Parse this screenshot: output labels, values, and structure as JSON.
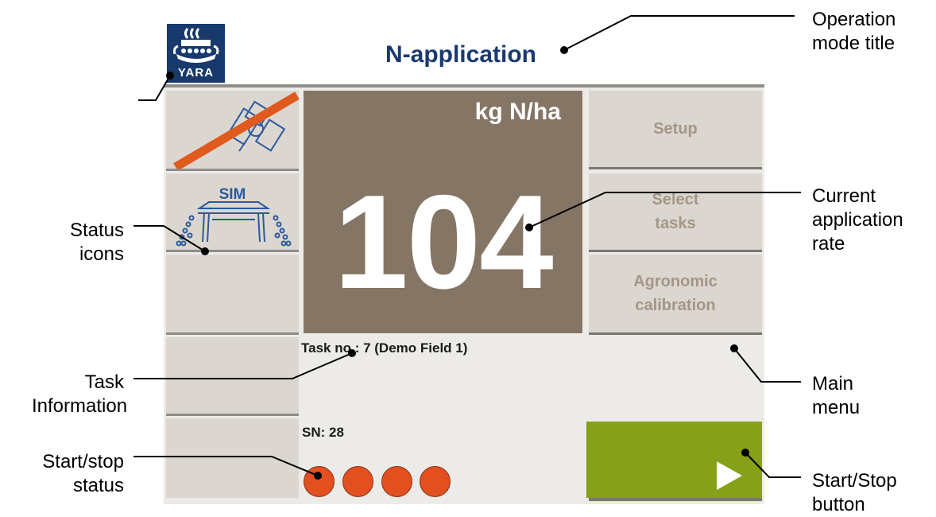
{
  "header": {
    "title": "N-application",
    "logo_text": "YARA"
  },
  "status_icons": [
    {
      "name": "gps-satellite-icon",
      "state": "no signal"
    },
    {
      "name": "spreader-sim-icon",
      "label": "SIM"
    }
  ],
  "rate": {
    "unit": "kg N/ha",
    "value": "104"
  },
  "menu": {
    "items": [
      {
        "label": "Setup"
      },
      {
        "label": "Select tasks"
      },
      {
        "label": "Agronomic calibration"
      }
    ]
  },
  "task": {
    "info": "Task no.: 7 (Demo Field 1)",
    "sn": "SN: 28"
  },
  "start_status": {
    "indicators": 4,
    "color": "#e25020"
  },
  "start_button": {
    "icon": "play-icon",
    "color": "#86a017"
  },
  "callouts": {
    "operation_mode_title": "Operation mode title",
    "status_icons": "Status icons",
    "current_rate": "Current application rate",
    "task_information": "Task Information",
    "main_menu": "Main menu",
    "start_stop_status": "Start/stop status",
    "start_stop_button": "Start/Stop button"
  },
  "colors": {
    "title": "#1a3a6e",
    "rate_panel": "#847565",
    "tile": "#dcd6d0",
    "logo": "#17396c"
  }
}
